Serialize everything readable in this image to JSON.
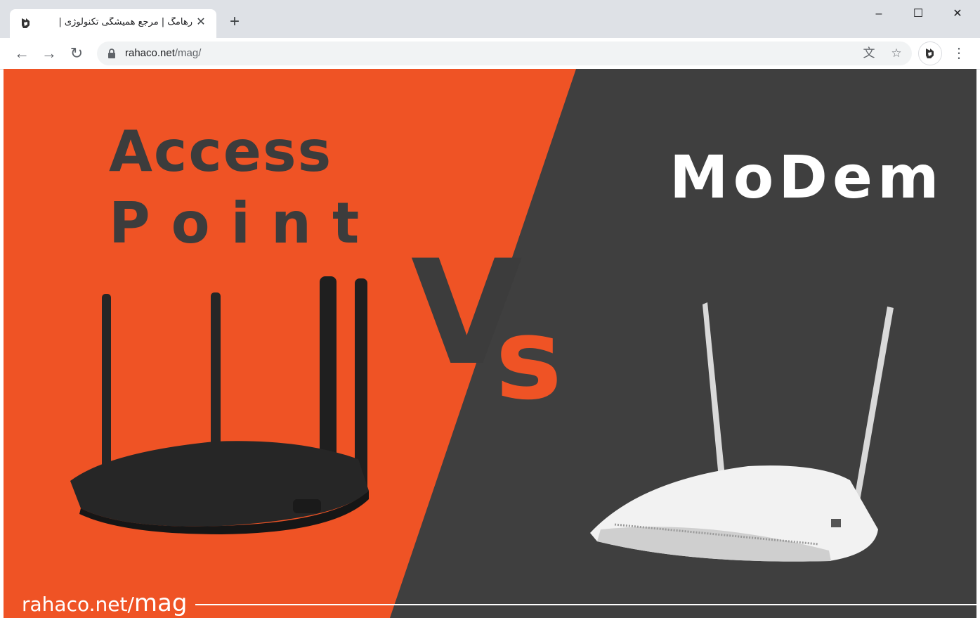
{
  "browser": {
    "tab": {
      "title": "رهامگ | مرجع همیشگی تکنولوژی |",
      "close_glyph": "✕",
      "favicon_icon": "rahaco-logo-icon"
    },
    "new_tab_glyph": "+",
    "window_controls": {
      "minimize": "–",
      "maximize": "☐",
      "close": "✕"
    },
    "nav": {
      "back_glyph": "←",
      "forward_glyph": "→",
      "reload_glyph": "↻"
    },
    "address": {
      "host": "rahaco.net",
      "path": "/mag/"
    },
    "toolbar_icons": {
      "translate_glyph": "文",
      "bookmark_glyph": "☆",
      "menu_glyph": "⋮"
    }
  },
  "hero": {
    "left_title_line1": "Access",
    "left_title_line2": "Point",
    "vs_v": "V",
    "vs_s": "s",
    "right_title": "MoDem",
    "watermark_host": "rahaco.net/",
    "watermark_path": "mag",
    "colors": {
      "orange": "#ef5325",
      "dark": "#3f3f3f",
      "title_dark": "#3c3c3c",
      "white": "#ffffff"
    }
  }
}
